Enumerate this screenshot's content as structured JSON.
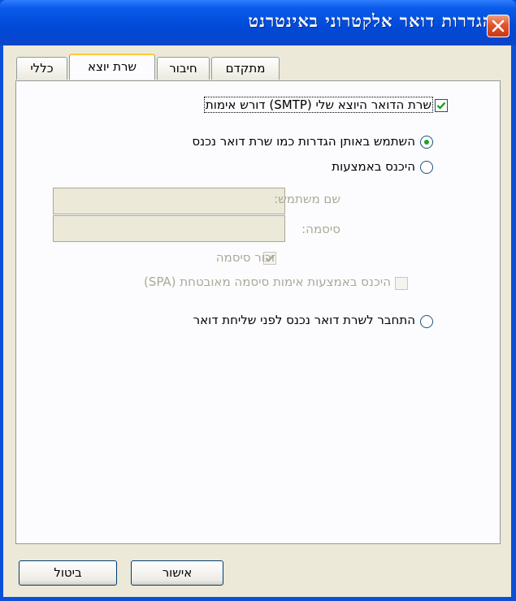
{
  "window": {
    "title": "הגדרות דואר אלקטרוני באינטרנט"
  },
  "tabs": [
    {
      "label": "כללי"
    },
    {
      "label": "שרת יוצא",
      "active": true
    },
    {
      "label": "חיבור"
    },
    {
      "label": "מתקדם"
    }
  ],
  "outgoing": {
    "requires_auth_label": "שרת הדואר היוצא שלי (SMTP) דורש אימות",
    "requires_auth_checked": true,
    "use_same_label": "השתמש באותן הגדרות כמו שרת דואר נכנס",
    "use_same_selected": true,
    "login_with_label": "היכנס באמצעות",
    "username_label": "שם משתמש:",
    "username_value": "",
    "password_label": "סיסמה:",
    "password_value": "",
    "remember_password_label": "זכור סיסמה",
    "remember_password_checked": true,
    "spa_label": "היכנס באמצעות אימות סיסמה מאובטחת (SPA)",
    "spa_checked": false,
    "log_on_before_label": "התחבר לשרת דואר נכנס לפני שליחת דואר"
  },
  "buttons": {
    "ok": "אישור",
    "cancel": "ביטול"
  },
  "colors": {
    "titlebar": "#0049d8",
    "dialog_bg": "#ece9d8",
    "tab_highlight": "#ffc83c",
    "radio_dot": "#21a121",
    "checkmark": "#21a121"
  }
}
